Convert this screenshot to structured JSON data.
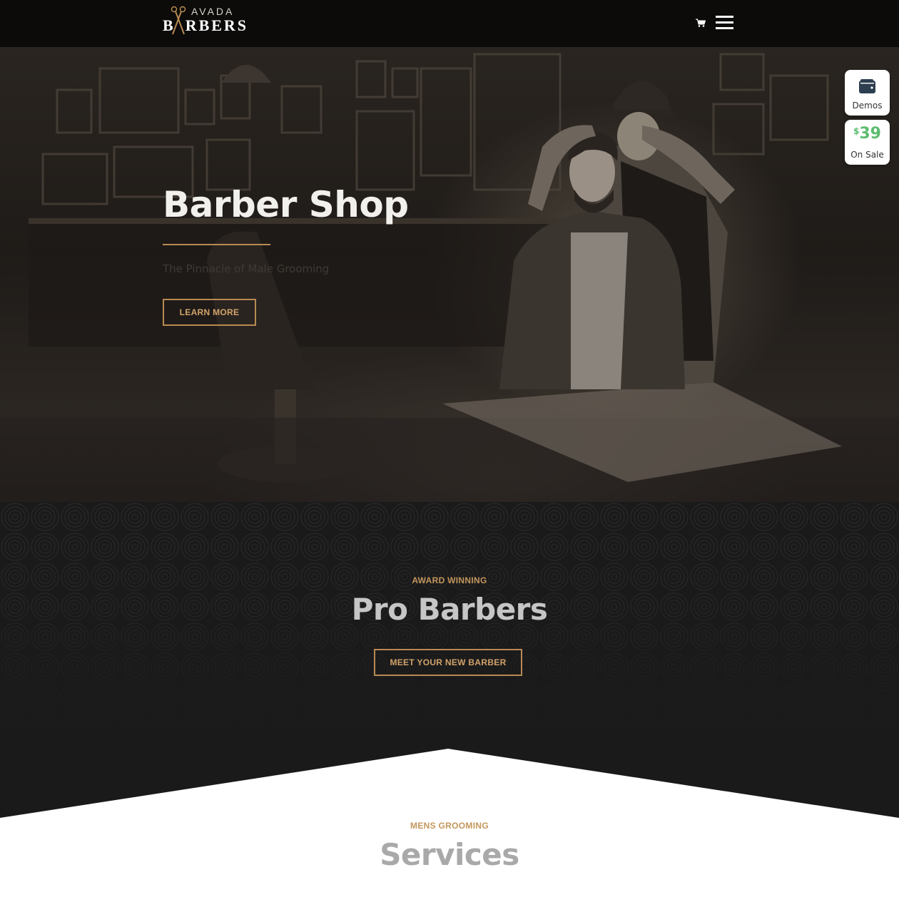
{
  "header": {
    "logo_top": "AVADA",
    "logo_bottom_left": "B",
    "logo_bottom_right": "RBERS",
    "cart_icon": "cart-icon",
    "menu_icon": "hamburger-menu-icon"
  },
  "hero": {
    "title": "Barber Shop",
    "subtitle": "The Pinnacle of Male Grooming",
    "button_label": "LEARN MORE"
  },
  "side_widgets": {
    "demos_label": "Demos",
    "demos_icon": "wallet-icon",
    "price_currency": "$",
    "price_value": "39",
    "sale_label": "On Sale"
  },
  "pro_section": {
    "eyebrow": "AWARD WINNING",
    "title": "Pro Barbers",
    "button_label": "MEET YOUR NEW BARBER"
  },
  "services_section": {
    "eyebrow": "MENS GROOMING",
    "title": "Services"
  },
  "colors": {
    "accent": "#b78a52",
    "accent_text": "#c4965c",
    "header_bg": "#0c0b0a",
    "dark_section": "#1a1a1b",
    "sale_green": "#5cbc6f"
  }
}
